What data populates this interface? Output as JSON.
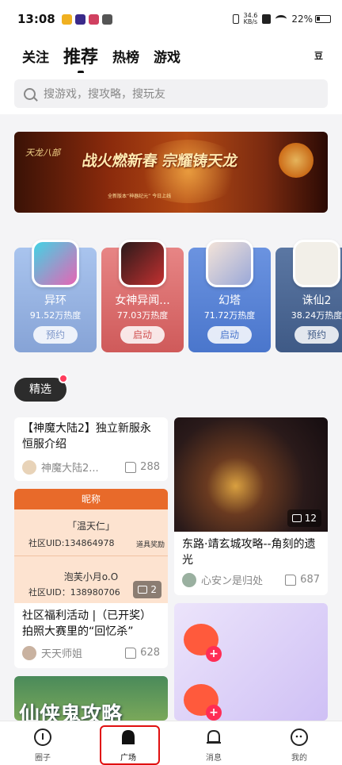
{
  "status_bar": {
    "time": "13:08",
    "net_speed_value": "34.6",
    "net_speed_unit": "KB/s",
    "battery": "22%"
  },
  "tabs": [
    "关注",
    "推荐",
    "热榜",
    "游戏"
  ],
  "active_tab": "推荐",
  "header_right": "豆",
  "search": {
    "placeholder": "搜游戏，搜攻略，搜玩友"
  },
  "banner": {
    "logo_text": "天龙八部",
    "headline": "战火燃新春 宗耀铸天龙",
    "subline": "全新版本“神器纪元” 今日上线"
  },
  "games": [
    {
      "name": "异环",
      "heat": "91.52万热度",
      "button": "预约",
      "color": "#9fb9e4"
    },
    {
      "name": "女神异闻...",
      "heat": "77.03万热度",
      "button": "启动",
      "color": "#dd6a6a"
    },
    {
      "name": "幻塔",
      "heat": "71.72万热度",
      "button": "启动",
      "color": "#5a86d8"
    },
    {
      "name": "诛仙2",
      "heat": "38.24万热度",
      "button": "预约",
      "color": "#4d6a96"
    }
  ],
  "section_label": "精选",
  "feed": {
    "card1": {
      "title": "【神魔大陆2】独立新服永恒服介绍",
      "author": "神魔大陆2...",
      "likes": "288"
    },
    "card2": {
      "table_header": "昵称",
      "row1_name": "「温天仁」",
      "row1_uid": "社区UID:134864978",
      "row1_extra": "道具奖励",
      "row2_name": "泡芙小月o.O",
      "row2_uid": "社区UID：138980706",
      "image_count": "2",
      "title": "社区福利活动 |（已开奖）拍照大赛里的“回忆杀”",
      "author": "天天师姐",
      "likes": "628"
    },
    "card3": {
      "image_count": "12",
      "title": "东路·靖玄城攻略--角刻的遗光",
      "author": "心安ン是归处",
      "likes": "687"
    },
    "card4": {
      "title_fragment": "仙侠鬼攻略"
    }
  },
  "bottom_nav": [
    {
      "label": "圈子"
    },
    {
      "label": "广场"
    },
    {
      "label": "消息"
    },
    {
      "label": "我的"
    }
  ],
  "colors": {
    "accent_orange": "#e86a2a",
    "highlight_red": "#e01010"
  }
}
